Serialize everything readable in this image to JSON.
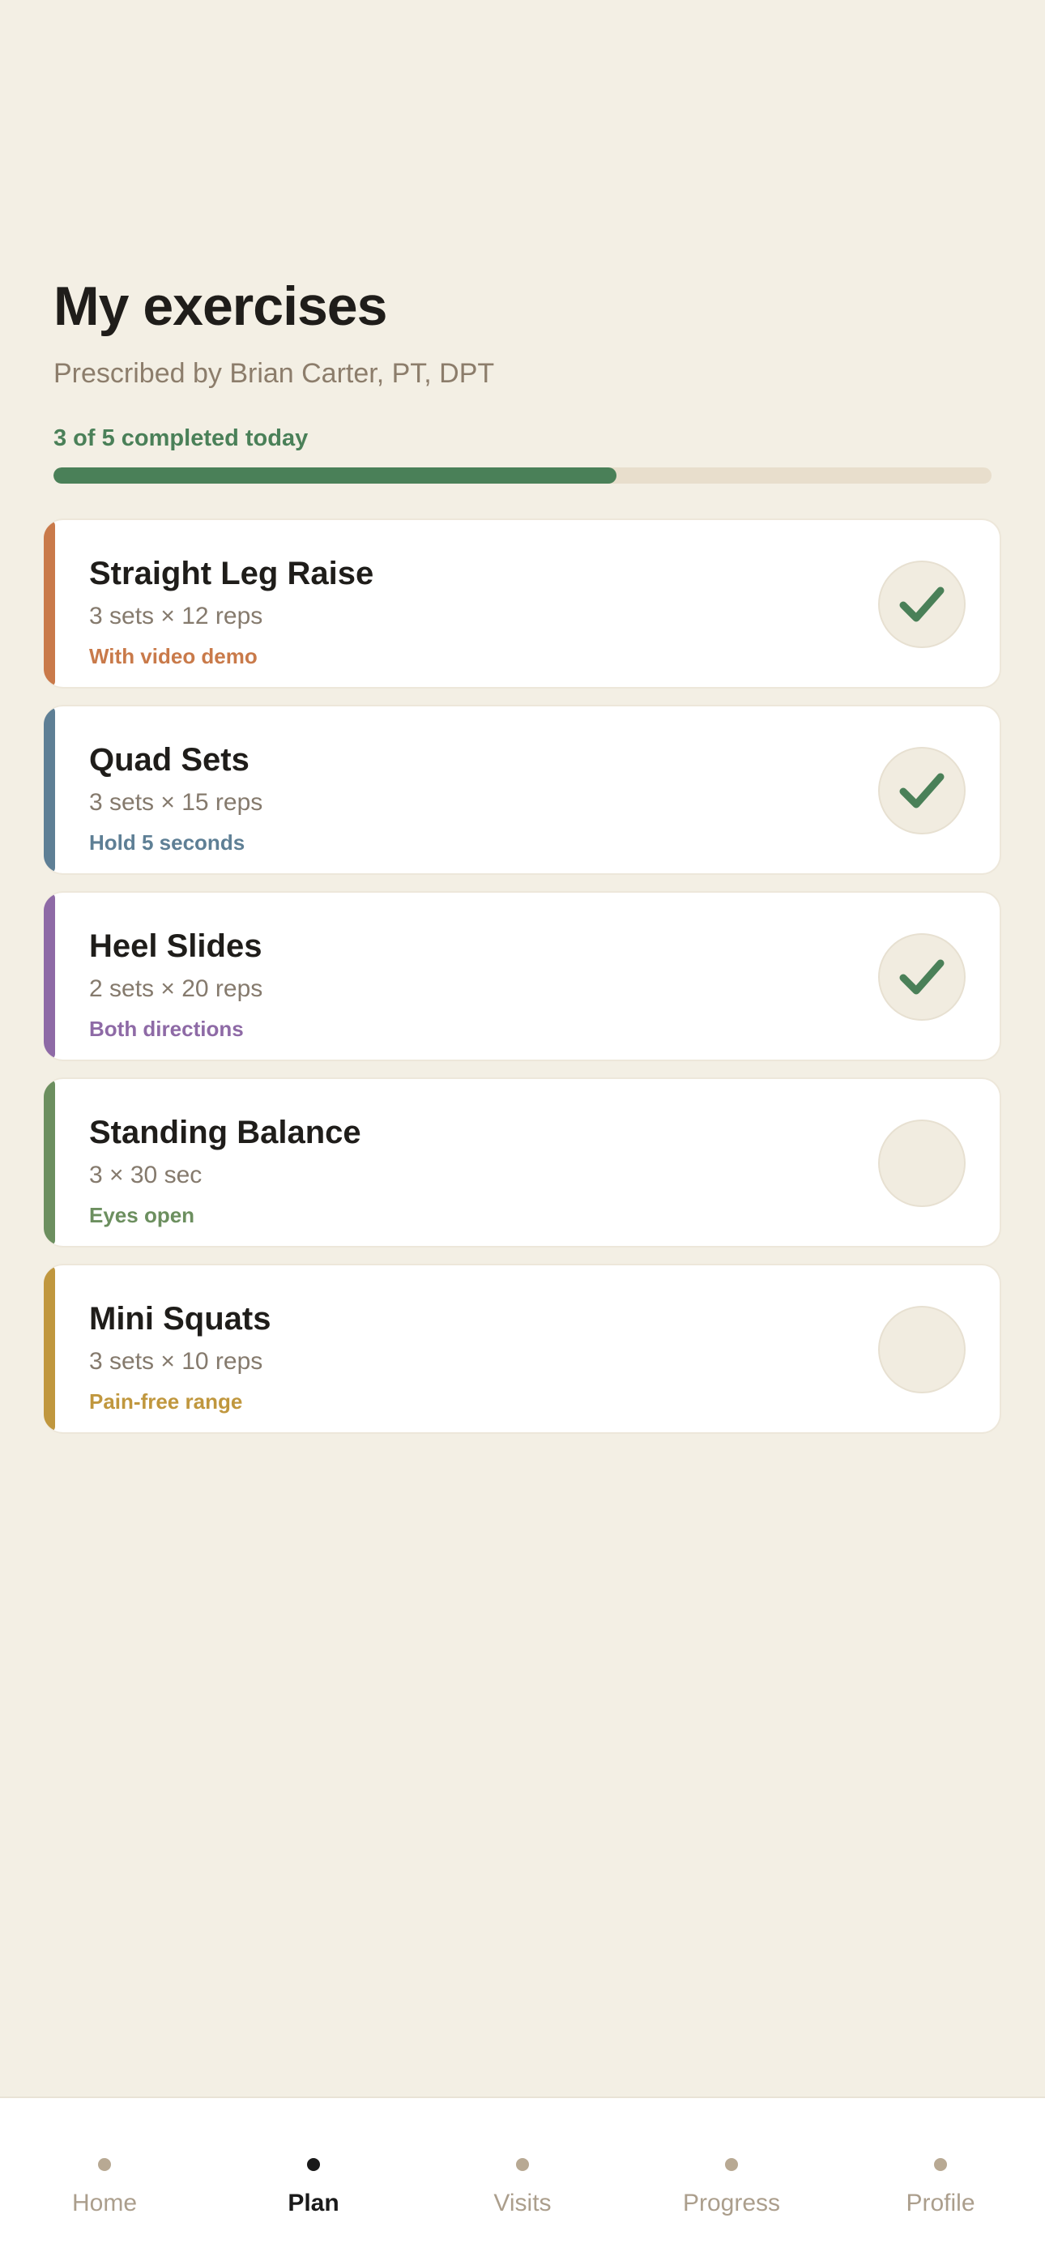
{
  "header": {
    "title": "My exercises",
    "subtitle": "Prescribed by Brian Carter, PT, DPT",
    "progress_label": "3 of 5 completed today",
    "progress_value": 0.6,
    "progress_color": "#4a8058"
  },
  "exercises": [
    {
      "name": "Straight Leg Raise",
      "detail": "3 sets × 12 reps",
      "note": "With video demo",
      "color": "#c97a4a",
      "completed": true
    },
    {
      "name": "Quad Sets",
      "detail": "3 sets × 15 reps",
      "note": "Hold 5 seconds",
      "color": "#5e7f95",
      "completed": true
    },
    {
      "name": "Heel Slides",
      "detail": "2 sets × 20 reps",
      "note": "Both directions",
      "color": "#8e6aa6",
      "completed": true
    },
    {
      "name": "Standing Balance",
      "detail": "3 × 30 sec",
      "note": "Eyes open",
      "color": "#6c8f5f",
      "completed": false
    },
    {
      "name": "Mini Squats",
      "detail": "3 sets × 10 reps",
      "note": "Pain-free range",
      "color": "#c0973e",
      "completed": false
    }
  ],
  "check_icon": "checkmark-icon",
  "check_color": "#4a8058",
  "tabs": [
    {
      "label": "Home",
      "active": false
    },
    {
      "label": "Plan",
      "active": true
    },
    {
      "label": "Visits",
      "active": false
    },
    {
      "label": "Progress",
      "active": false
    },
    {
      "label": "Profile",
      "active": false
    }
  ]
}
